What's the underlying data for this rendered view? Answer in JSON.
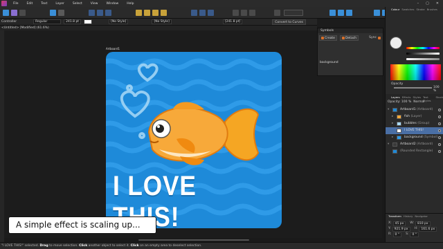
{
  "menu": {
    "items": [
      "File",
      "Edit",
      "Text",
      "Layer",
      "Select",
      "View",
      "Window",
      "Help"
    ]
  },
  "window": {
    "controls": [
      "–",
      "▢",
      "✕"
    ]
  },
  "context": {
    "tool_name": "Controller",
    "font_style": "Regular",
    "font_size": "241.8 pt",
    "style1": "[No Style]",
    "style2": "[No Style]",
    "tracking": "[241.8 pt]",
    "convert_label": "Convert to Curves"
  },
  "document": {
    "tab": "<Untitled> [Modified] (61.6%)"
  },
  "artboard": {
    "label": "Artboard1",
    "headline": "I LOVE THIS!",
    "colors": {
      "bg": "#1e8ad9",
      "wave": "#2f9be8",
      "heart": "#a9d9f7"
    }
  },
  "caption": "A simple effect is scaling up...",
  "symbols": {
    "title": "Symbols",
    "create": "Create",
    "detach": "Detach",
    "sync": "Sync",
    "item": "background"
  },
  "right": {
    "top_tabs": [
      "Colour",
      "Swatches",
      "Stroke",
      "Brushes"
    ],
    "opacity_label": "Opacity",
    "opacity_value": "100 %",
    "layer_tabs": [
      "Layers",
      "Effects",
      "Styles",
      "Text Styles",
      "Stock"
    ],
    "layer_opacity": "Opacity: 100 %",
    "blend": "Normal",
    "layers": [
      {
        "name": "Artboard1",
        "type": "(Artboard)"
      },
      {
        "name": "fish",
        "type": "(Layer)"
      },
      {
        "name": "bubbles",
        "type": "(Group)"
      },
      {
        "name": "I LOVE THIS!",
        "type": ""
      },
      {
        "name": "background",
        "type": "(Symbol)"
      },
      {
        "name": "Artboard2",
        "type": "(Artboard)"
      },
      {
        "name": "",
        "type": "(Rounded Rectangle)"
      }
    ],
    "tf_tabs": [
      "Transform",
      "History",
      "Navigator"
    ],
    "tf": {
      "x": "45 px",
      "y": "921.9 px",
      "w": "810 px",
      "h": "161.6 px",
      "r": "0 °",
      "s": "0 °"
    }
  },
  "status": {
    "pre": "\"I LOVE THIS!\" selected. ",
    "drag": "Drag",
    "mid1": " to move selection. ",
    "click1": "Click",
    "mid2": " another object to select it. ",
    "click2": "Click",
    "post": " on an empty area to deselect selection."
  }
}
